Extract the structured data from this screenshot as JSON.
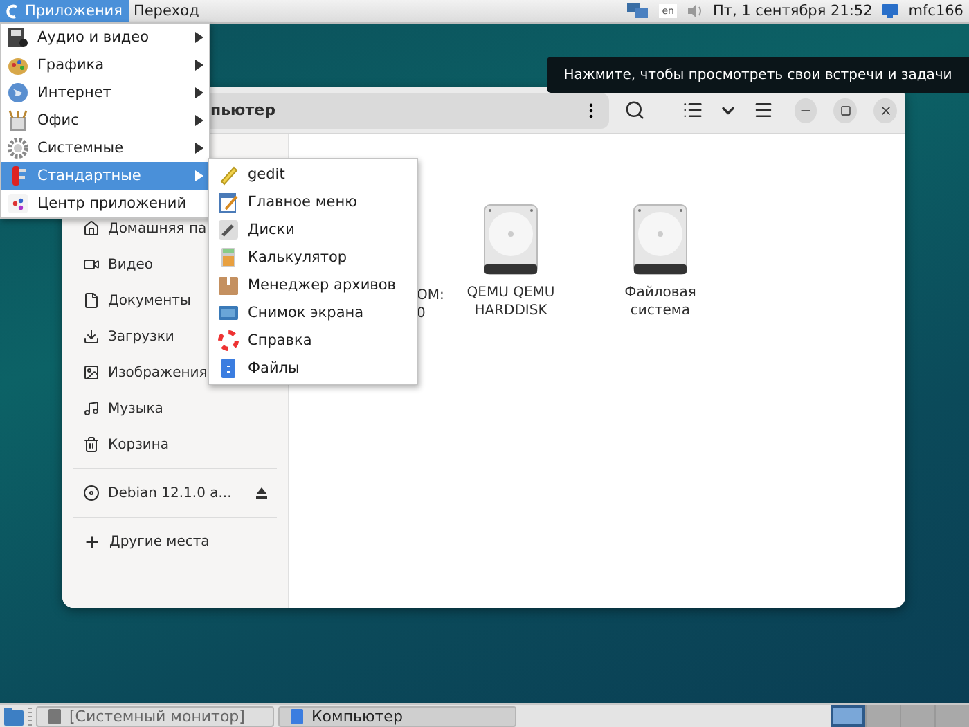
{
  "top_panel": {
    "menus": [
      {
        "label": "Приложения",
        "selected": true
      },
      {
        "label": "Переход",
        "selected": false
      }
    ],
    "keyboard_layout": "en",
    "clock": "Пт, 1 сентября 21:52",
    "user": "mfc166"
  },
  "tooltip": "Нажмите, чтобы просмотреть свои встречи и задачи",
  "app_menu": {
    "items": [
      {
        "label": "Аудио и видео",
        "submenu": true,
        "selected": false
      },
      {
        "label": "Графика",
        "submenu": true,
        "selected": false
      },
      {
        "label": "Интернет",
        "submenu": true,
        "selected": false
      },
      {
        "label": "Офис",
        "submenu": true,
        "selected": false
      },
      {
        "label": "Системные",
        "submenu": true,
        "selected": false
      },
      {
        "label": "Стандартные",
        "submenu": true,
        "selected": true
      },
      {
        "label": "Центр приложений",
        "submenu": false,
        "selected": false
      }
    ]
  },
  "submenu": {
    "items": [
      "gedit",
      "Главное меню",
      "Диски",
      "Калькулятор",
      "Менеджер архивов",
      "Снимок экрана",
      "Справка",
      "Файлы"
    ]
  },
  "file_manager": {
    "title": "пьютер",
    "sidebar": {
      "places": [
        "Домашняя па",
        "Видео",
        "Документы",
        "Загрузки",
        "Изображения",
        "Музыка",
        "Корзина"
      ],
      "volumes": [
        {
          "label": "Debian 12.1.0 a...",
          "eject": true
        }
      ],
      "other": "Другие места"
    },
    "items": [
      {
        "kind": "partial",
        "label": "ОМ:\n0"
      },
      {
        "kind": "drive",
        "label": "QEMU QEMU\nHARDDISK"
      },
      {
        "kind": "drive",
        "label": "Файловая\nсистема"
      }
    ]
  },
  "taskbar": {
    "windows": [
      {
        "label": "[Системный монитор]",
        "selected": false
      },
      {
        "label": "Компьютер",
        "selected": true
      }
    ],
    "workspaces": [
      {
        "selected": true
      },
      {
        "selected": false
      },
      {
        "selected": false
      },
      {
        "selected": false
      }
    ]
  }
}
